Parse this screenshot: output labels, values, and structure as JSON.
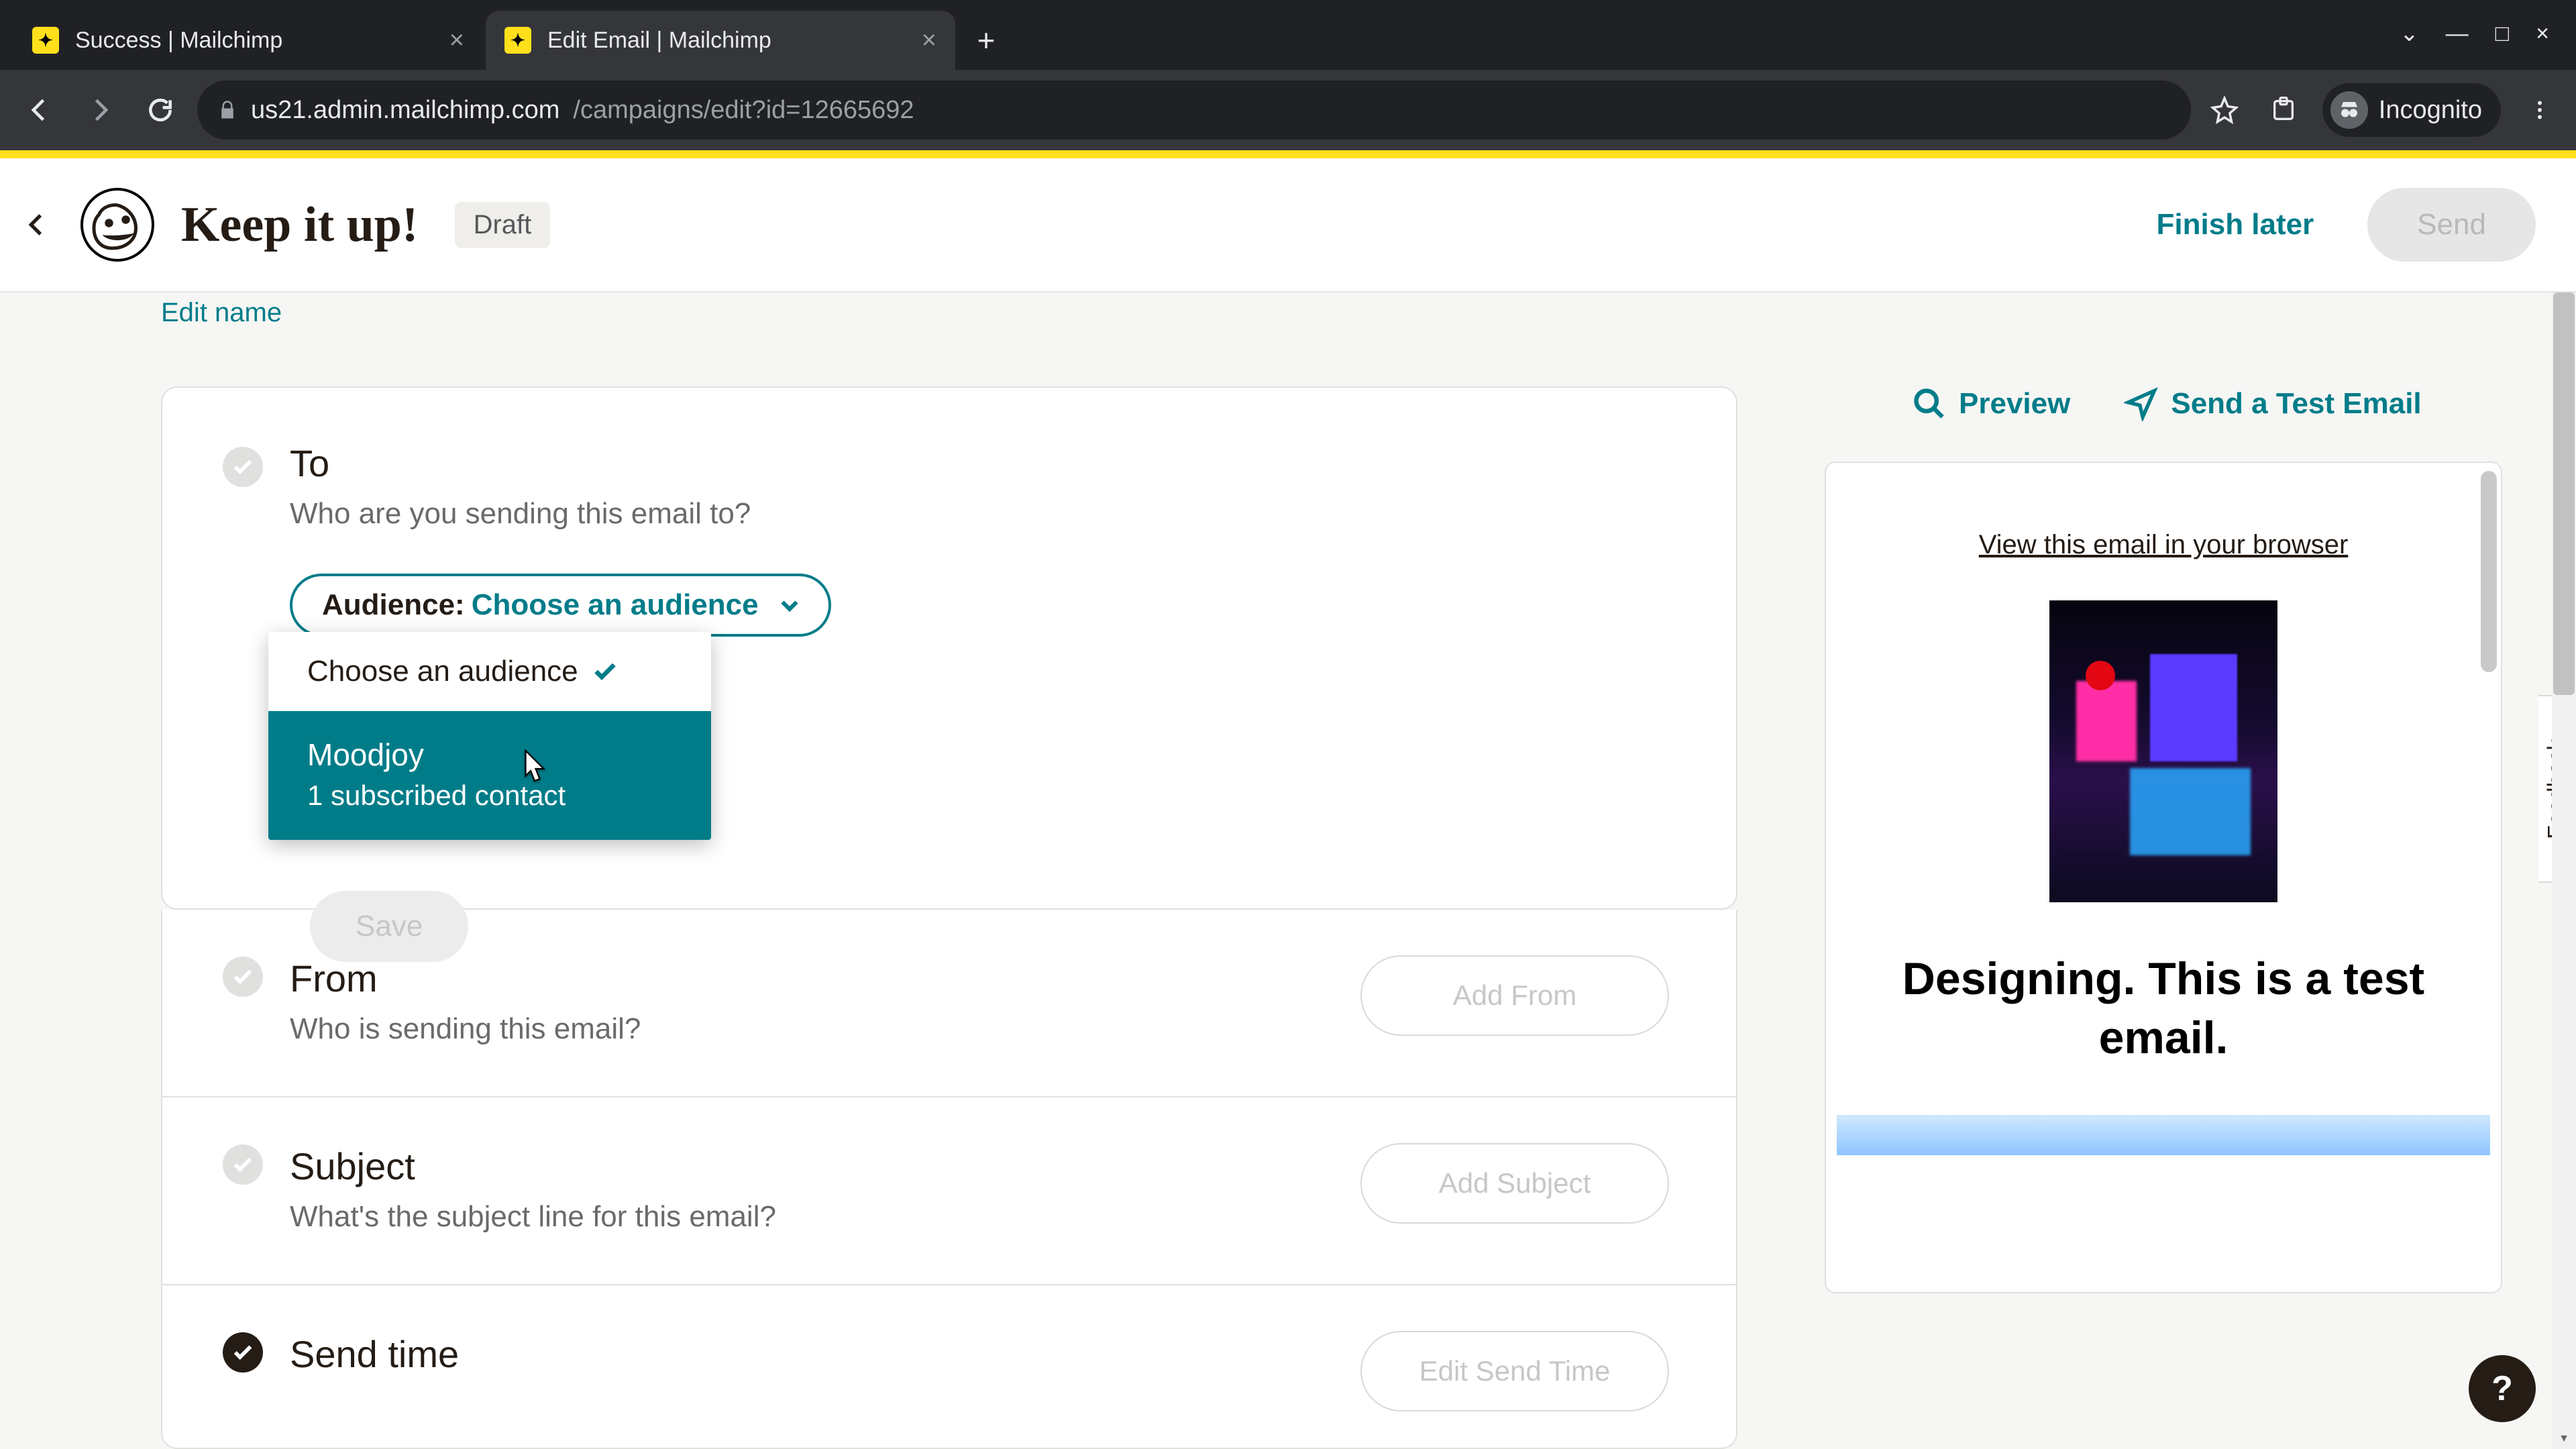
{
  "browser": {
    "tabs": [
      {
        "title": "Success | Mailchimp"
      },
      {
        "title": "Edit Email | Mailchimp"
      }
    ],
    "url_domain": "us21.admin.mailchimp.com",
    "url_path": "/campaigns/edit?id=12665692",
    "incognito_label": "Incognito"
  },
  "header": {
    "title": "Keep it up!",
    "status_badge": "Draft",
    "finish_later": "Finish later",
    "send": "Send"
  },
  "page": {
    "edit_name": "Edit name"
  },
  "sections": {
    "to": {
      "title": "To",
      "subtitle": "Who are you sending this email to?",
      "audience_label": "Audience:",
      "audience_value": "Choose an audience",
      "save": "Save"
    },
    "from": {
      "title": "From",
      "subtitle": "Who is sending this email?",
      "action": "Add From"
    },
    "subject": {
      "title": "Subject",
      "subtitle": "What's the subject line for this email?",
      "action": "Add Subject"
    },
    "send_time": {
      "title": "Send time",
      "action": "Edit Send Time"
    }
  },
  "audience_dropdown": {
    "placeholder": "Choose an audience",
    "options": [
      {
        "name": "Moodjoy",
        "sub": "1 subscribed contact"
      }
    ]
  },
  "right": {
    "preview": "Preview",
    "send_test": "Send a Test Email"
  },
  "preview_email": {
    "browser_link": "View this email in your browser",
    "headline": "Designing. This is a test email."
  },
  "feedback": "Feedback",
  "help": "?"
}
